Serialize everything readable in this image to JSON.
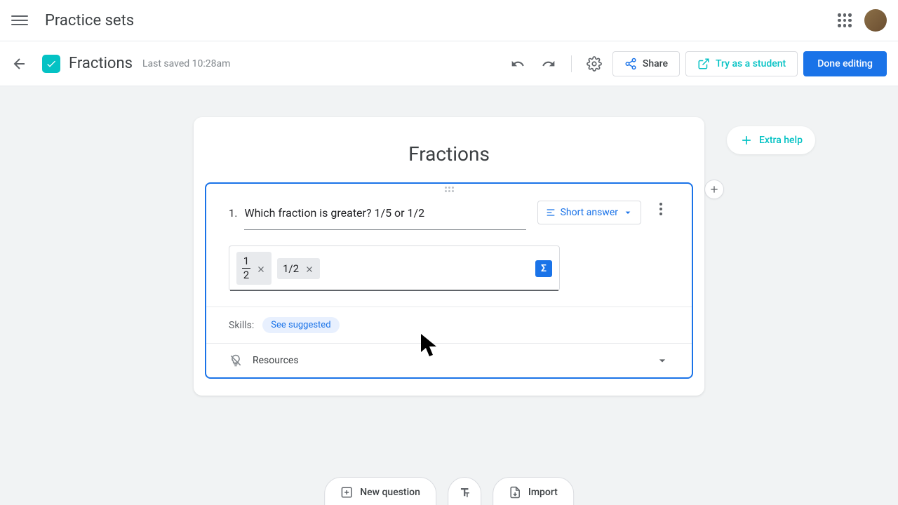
{
  "header": {
    "app_title": "Practice sets"
  },
  "toolbar": {
    "doc_title": "Fractions",
    "save_status": "Last saved 10:28am",
    "share_label": "Share",
    "try_label": "Try as a student",
    "done_label": "Done editing"
  },
  "content": {
    "card_title": "Fractions",
    "extra_help_label": "Extra help"
  },
  "question": {
    "number": "1.",
    "text": "Which fraction is greater? 1/5 or 1/2",
    "type_label": "Short answer",
    "answers": [
      {
        "numerator": "1",
        "denominator": "2"
      },
      {
        "text": "1/2"
      }
    ],
    "sigma": "Σ",
    "skills_label": "Skills:",
    "suggest_label": "See suggested",
    "resources_label": "Resources"
  },
  "bottom": {
    "new_question_label": "New question",
    "import_label": "Import"
  }
}
